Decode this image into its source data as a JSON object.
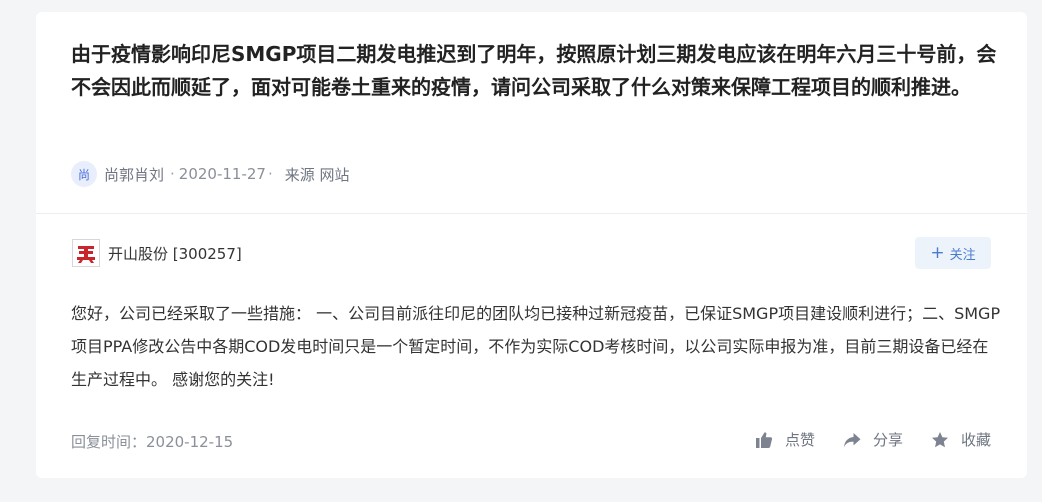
{
  "question": {
    "text": "由于疫情影响印尼SMGP项目二期发电推迟到了明年，按照原计划三期发电应该在明年六月三十号前，会不会因此而顺延了，面对可能卷土重来的疫情，请问公司采取了什么对策来保障工程项目的顺利推进。",
    "avatar_char": "尚",
    "author": "尚郭肖刘",
    "date": "2020-11-27",
    "source_label": "来源 网站"
  },
  "answer": {
    "company": "开山股份 [300257]",
    "follow_label": "关注",
    "text": "您好，公司已经采取了一些措施： 一、公司目前派往印尼的团队均已接种过新冠疫苗，已保证SMGP项目建设顺利进行；二、SMGP项目PPA修改公告中各期COD发电时间只是一个暂定时间，不作为实际COD考核时间，以公司实际申报为准，目前三期设备已经在生产过程中。 感谢您的关注!",
    "reply_time": "回复时间：2020-12-15"
  },
  "actions": {
    "like": "点赞",
    "share": "分享",
    "favorite": "收藏"
  },
  "icons": {
    "avatar": "avatar-icon",
    "company_logo": "company-logo-icon",
    "follow": "plus-icon",
    "like": "thumbs-up-icon",
    "share": "share-arrow-icon",
    "favorite": "star-icon"
  },
  "colors": {
    "accent": "#4a7bd0",
    "logo_red": "#c8262b",
    "muted_text": "#8a8f99"
  }
}
